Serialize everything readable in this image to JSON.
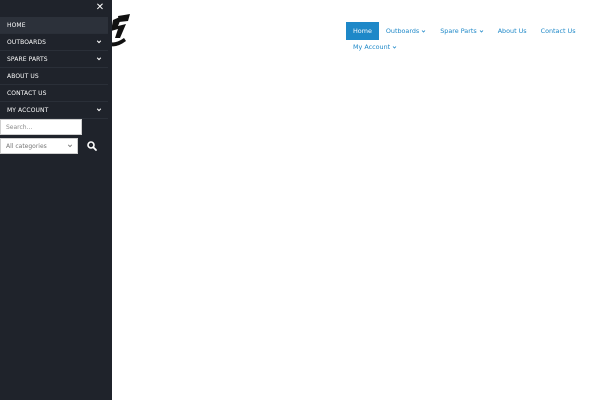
{
  "drawer": {
    "close_icon": "✕",
    "menu": [
      {
        "label": "HOME",
        "active": true,
        "has_children": false
      },
      {
        "label": "OUTBOARDS",
        "active": false,
        "has_children": true
      },
      {
        "label": "SPARE PARTS",
        "active": false,
        "has_children": true
      },
      {
        "label": "ABOUT US",
        "active": false,
        "has_children": false
      },
      {
        "label": "CONTACT US",
        "active": false,
        "has_children": false
      },
      {
        "label": "MY ACCOUNT",
        "active": false,
        "has_children": true
      }
    ],
    "search_placeholder": "Search...",
    "category_selected": "All categories"
  },
  "topnav": {
    "items": [
      {
        "label": "Home"
      },
      {
        "label": "Outboards"
      },
      {
        "label": "Spare Parts"
      },
      {
        "label": "About Us"
      },
      {
        "label": "Contact Us"
      },
      {
        "label": "My Account"
      }
    ]
  },
  "colors": {
    "accent": "#1e88c8",
    "drawer_bg": "#1f232b"
  },
  "icons": {
    "close": "close-icon",
    "chevron": "chevron-down-icon",
    "search": "search-icon"
  }
}
